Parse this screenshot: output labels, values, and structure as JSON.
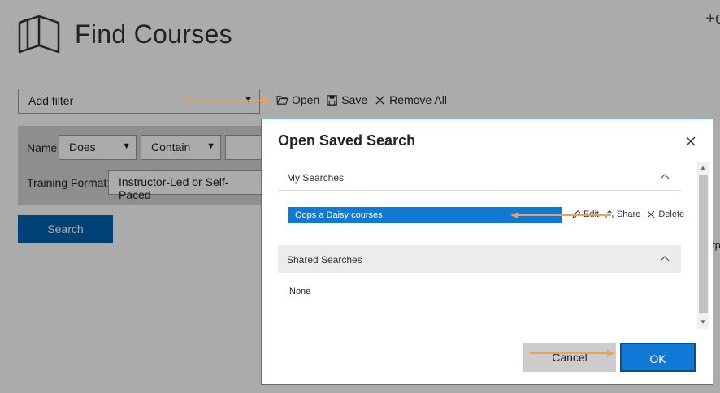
{
  "page": {
    "title": "Find Courses",
    "top_right_action": "+c",
    "filter": {
      "selected": "Add filter"
    },
    "saved_actions": {
      "open": "Open",
      "save": "Save",
      "remove_all": "Remove All"
    },
    "criteria": {
      "name_label": "Name",
      "name_operator": "Does",
      "name_match": "Contain",
      "format_label": "Training Format:",
      "format_value": "Instructor-Led or Self-Paced"
    },
    "search_button": "Search",
    "fragment": "tp"
  },
  "dialog": {
    "title": "Open Saved Search",
    "my_searches": {
      "label": "My Searches",
      "items": [
        {
          "name": "Oops a Daisy courses"
        }
      ],
      "actions": {
        "edit": "Edit",
        "share": "Share",
        "delete": "Delete"
      }
    },
    "shared_searches": {
      "label": "Shared Searches",
      "empty_text": "None"
    },
    "cancel_label": "Cancel",
    "ok_label": "OK"
  },
  "colors": {
    "accent": "#0f7ad6",
    "search_button": "#0063b1",
    "annotation_arrow": "#f0a050",
    "overlay": "rgba(0,0,0,0.33)"
  },
  "icons": {
    "header": "book-open-icon",
    "open": "folder-open-icon",
    "save": "floppy-disk-icon",
    "remove_all": "close-icon",
    "edit": "pencil-icon",
    "share": "share-icon",
    "delete": "close-icon"
  }
}
